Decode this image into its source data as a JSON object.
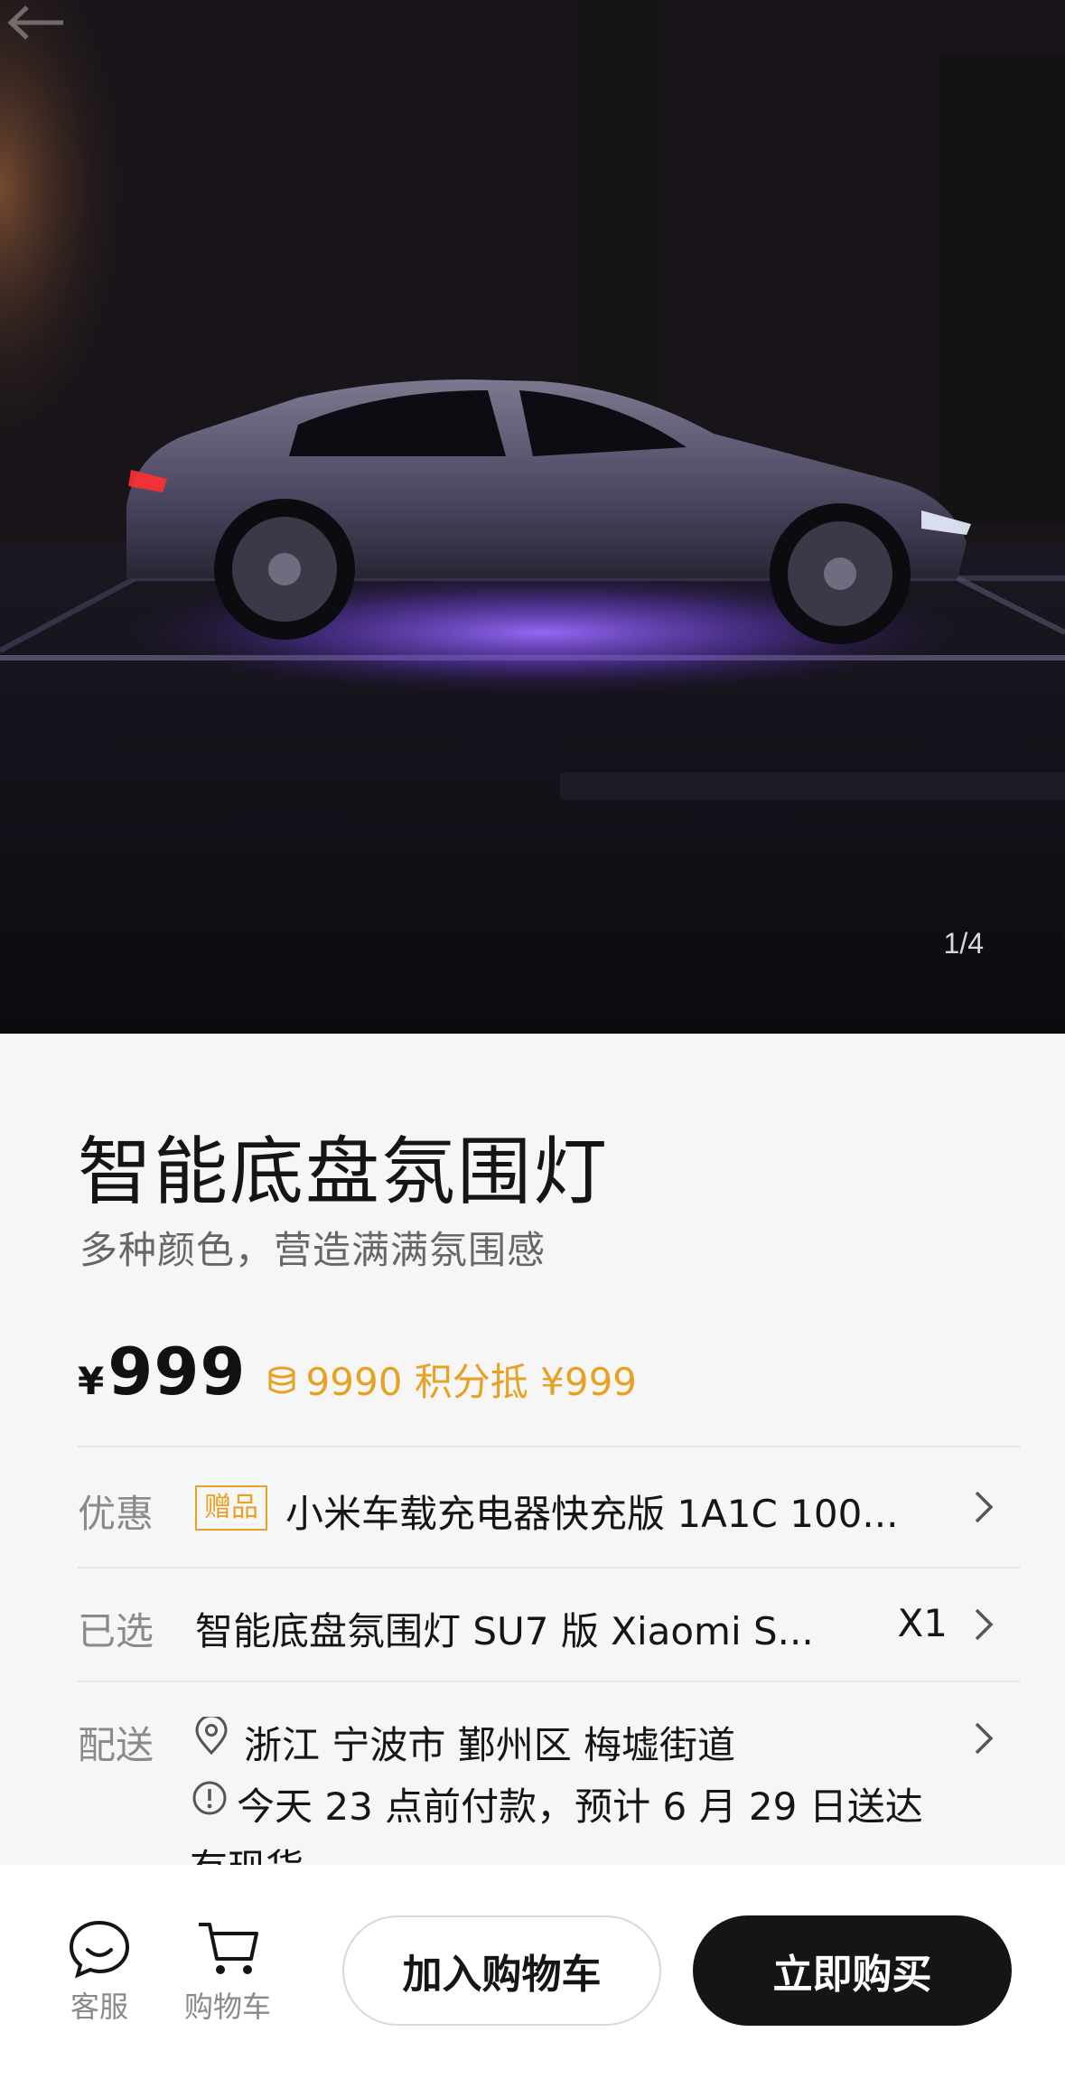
{
  "gallery": {
    "counter": "1/4"
  },
  "product": {
    "title": "智能底盘氛围灯",
    "subtitle": "多种颜色，营造满满氛围感",
    "currency": "¥",
    "price": "999",
    "points_text": "9990 积分抵 ¥999"
  },
  "rows": {
    "promo": {
      "label": "优惠",
      "badge": "赠品",
      "text": "小米车载充电器快充版 1A1C 100..."
    },
    "selected": {
      "label": "已选",
      "text": "智能底盘氛围灯 SU7 版  Xiaomi S...",
      "qty": "X1"
    },
    "delivery": {
      "label": "配送",
      "address": "浙江 宁波市 鄞州区 梅墟街道",
      "eta": "今天 23 点前付款，预计 6 月 29 日送达",
      "stock": "有现货"
    }
  },
  "bottom_bar": {
    "service_label": "客服",
    "cart_label": "购物车",
    "add_to_cart": "加入购物车",
    "buy_now": "立即购买"
  },
  "colors": {
    "accent": "#e7a124",
    "primary_button": "#151515",
    "underglow": "#8a5cff"
  }
}
